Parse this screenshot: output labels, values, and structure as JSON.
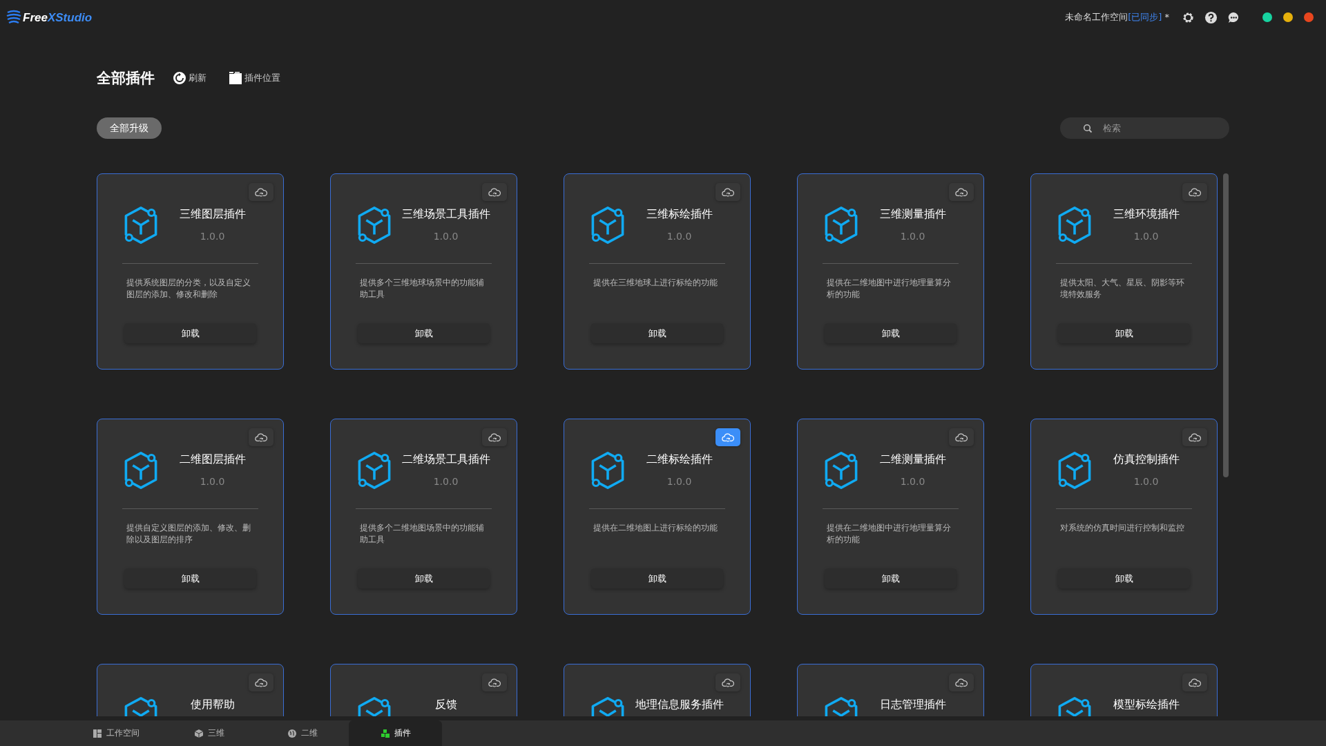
{
  "app": {
    "logo_parts": [
      "Free",
      "XStudio"
    ],
    "workspace_parts": [
      "未命名工作空间",
      "[已同步]",
      " *"
    ]
  },
  "header": {
    "title": "全部插件",
    "refresh": "刷新",
    "location": "插件位置"
  },
  "upgrade_all": "全部升级",
  "search": {
    "placeholder": "检索"
  },
  "plugins": [
    {
      "title": "三维图层插件",
      "version": "1.0.0",
      "description": "提供系统图层的分类，以及自定义图层的添加、修改和删除",
      "button": "卸载",
      "selected": false
    },
    {
      "title": "三维场景工具插件",
      "version": "1.0.0",
      "description": "提供多个三维地球场景中的功能辅助工具",
      "button": "卸载",
      "selected": false
    },
    {
      "title": "三维标绘插件",
      "version": "1.0.0",
      "description": "提供在三维地球上进行标绘的功能",
      "button": "卸载",
      "selected": false
    },
    {
      "title": "三维测量插件",
      "version": "1.0.0",
      "description": "提供在二维地图中进行地理量算分析的功能",
      "button": "卸载",
      "selected": false
    },
    {
      "title": "三维环境插件",
      "version": "1.0.0",
      "description": "提供太阳、大气、星辰、阴影等环境特效服务",
      "button": "卸载",
      "selected": false
    },
    {
      "title": "二维图层插件",
      "version": "1.0.0",
      "description": "提供自定义图层的添加、修改、删除以及图层的排序",
      "button": "卸载",
      "selected": false
    },
    {
      "title": "二维场景工具插件",
      "version": "1.0.0",
      "description": "提供多个二维地图场景中的功能辅助工具",
      "button": "卸载",
      "selected": false
    },
    {
      "title": "二维标绘插件",
      "version": "1.0.0",
      "description": "提供在二维地图上进行标绘的功能",
      "button": "卸载",
      "selected": true
    },
    {
      "title": "二维测量插件",
      "version": "1.0.0",
      "description": "提供在二维地图中进行地理量算分析的功能",
      "button": "卸载",
      "selected": false
    },
    {
      "title": "仿真控制插件",
      "version": "1.0.0",
      "description": "对系统的仿真时间进行控制和监控",
      "button": "卸载",
      "selected": false
    },
    {
      "title": "使用帮助",
      "selected": false
    },
    {
      "title": "反馈",
      "selected": false
    },
    {
      "title": "地理信息服务插件",
      "selected": false
    },
    {
      "title": "日志管理插件",
      "selected": false
    },
    {
      "title": "模型标绘插件",
      "selected": false
    }
  ],
  "taskbar": [
    {
      "kind": "workspace",
      "label": "工作空间",
      "selected": false
    },
    {
      "kind": "scene3d",
      "label": "三维",
      "selected": false
    },
    {
      "kind": "map2d",
      "label": "二维",
      "selected": false
    },
    {
      "kind": "plugins",
      "label": "插件",
      "selected": true
    }
  ]
}
